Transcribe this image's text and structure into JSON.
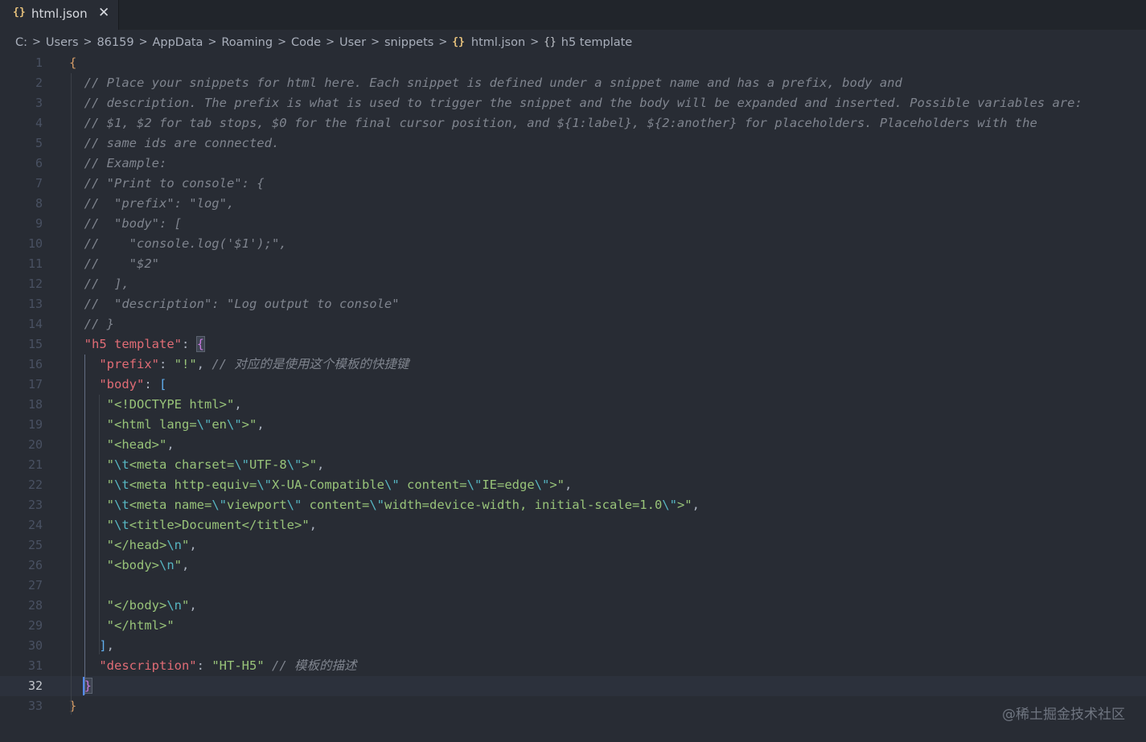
{
  "tab": {
    "icon": "{}",
    "label": "html.json",
    "close": "✕"
  },
  "breadcrumb": {
    "items": [
      "C:",
      "Users",
      "86159",
      "AppData",
      "Roaming",
      "Code",
      "User",
      "snippets"
    ],
    "file_icon": "{}",
    "file": "html.json",
    "symbol_icon": "{}",
    "symbol": "h5 template"
  },
  "editor": {
    "active_line": 32,
    "lines": [
      [
        [
          "{",
          "brace"
        ]
      ],
      [
        [
          "  // Place your snippets for html here. Each snippet is defined under a snippet name and has a prefix, body and",
          "comment"
        ]
      ],
      [
        [
          "  // description. The prefix is what is used to trigger the snippet and the body will be expanded and inserted. Possible variables are:",
          "comment"
        ]
      ],
      [
        [
          "  // $1, $2 for tab stops, $0 for the final cursor position, and ${1:label}, ${2:another} for placeholders. Placeholders with the",
          "comment"
        ]
      ],
      [
        [
          "  // same ids are connected.",
          "comment"
        ]
      ],
      [
        [
          "  // Example:",
          "comment"
        ]
      ],
      [
        [
          "  // \"Print to console\": {",
          "comment"
        ]
      ],
      [
        [
          "  //  \"prefix\": \"log\",",
          "comment"
        ]
      ],
      [
        [
          "  //  \"body\": [",
          "comment"
        ]
      ],
      [
        [
          "  //    \"console.log('$1');\",",
          "comment"
        ]
      ],
      [
        [
          "  //    \"$2\"",
          "comment"
        ]
      ],
      [
        [
          "  //  ],",
          "comment"
        ]
      ],
      [
        [
          "  //  \"description\": \"Log output to console\"",
          "comment"
        ]
      ],
      [
        [
          "  // }",
          "comment"
        ]
      ],
      [
        [
          "  ",
          "punc"
        ],
        [
          "\"h5 template\"",
          "key"
        ],
        [
          ": ",
          "punc"
        ],
        [
          "{",
          "brace-hl"
        ]
      ],
      [
        [
          "    ",
          "punc"
        ],
        [
          "\"prefix\"",
          "key"
        ],
        [
          ": ",
          "punc"
        ],
        [
          "\"!\"",
          "str"
        ],
        [
          ", ",
          "punc"
        ],
        [
          "// 对应的是使用这个模板的快捷键",
          "comment"
        ]
      ],
      [
        [
          "    ",
          "punc"
        ],
        [
          "\"body\"",
          "key"
        ],
        [
          ": ",
          "punc"
        ],
        [
          "[",
          "bracket"
        ]
      ],
      [
        [
          "     ",
          "punc"
        ],
        [
          "\"<!DOCTYPE html>\"",
          "str"
        ],
        [
          ",",
          "punc"
        ]
      ],
      [
        [
          "     ",
          "punc"
        ],
        [
          "\"<html lang=",
          "str"
        ],
        [
          "\\\"",
          "esc"
        ],
        [
          "en",
          "str"
        ],
        [
          "\\\"",
          "esc"
        ],
        [
          ">\"",
          "str"
        ],
        [
          ",",
          "punc"
        ]
      ],
      [
        [
          "     ",
          "punc"
        ],
        [
          "\"<head>\"",
          "str"
        ],
        [
          ",",
          "punc"
        ]
      ],
      [
        [
          "     ",
          "punc"
        ],
        [
          "\"",
          "str"
        ],
        [
          "\\t",
          "esc"
        ],
        [
          "<meta charset=",
          "str"
        ],
        [
          "\\\"",
          "esc"
        ],
        [
          "UTF-8",
          "str"
        ],
        [
          "\\\"",
          "esc"
        ],
        [
          ">\"",
          "str"
        ],
        [
          ",",
          "punc"
        ]
      ],
      [
        [
          "     ",
          "punc"
        ],
        [
          "\"",
          "str"
        ],
        [
          "\\t",
          "esc"
        ],
        [
          "<meta http-equiv=",
          "str"
        ],
        [
          "\\\"",
          "esc"
        ],
        [
          "X-UA-Compatible",
          "str"
        ],
        [
          "\\\"",
          "esc"
        ],
        [
          " content=",
          "str"
        ],
        [
          "\\\"",
          "esc"
        ],
        [
          "IE=edge",
          "str"
        ],
        [
          "\\\"",
          "esc"
        ],
        [
          ">\"",
          "str"
        ],
        [
          ",",
          "punc"
        ]
      ],
      [
        [
          "     ",
          "punc"
        ],
        [
          "\"",
          "str"
        ],
        [
          "\\t",
          "esc"
        ],
        [
          "<meta name=",
          "str"
        ],
        [
          "\\\"",
          "esc"
        ],
        [
          "viewport",
          "str"
        ],
        [
          "\\\"",
          "esc"
        ],
        [
          " content=",
          "str"
        ],
        [
          "\\\"",
          "esc"
        ],
        [
          "width=device-width, initial-scale=1.0",
          "str"
        ],
        [
          "\\\"",
          "esc"
        ],
        [
          ">\"",
          "str"
        ],
        [
          ",",
          "punc"
        ]
      ],
      [
        [
          "     ",
          "punc"
        ],
        [
          "\"",
          "str"
        ],
        [
          "\\t",
          "esc"
        ],
        [
          "<title>Document</title>\"",
          "str"
        ],
        [
          ",",
          "punc"
        ]
      ],
      [
        [
          "     ",
          "punc"
        ],
        [
          "\"</head>",
          "str"
        ],
        [
          "\\n",
          "esc"
        ],
        [
          "\"",
          "str"
        ],
        [
          ",",
          "punc"
        ]
      ],
      [
        [
          "     ",
          "punc"
        ],
        [
          "\"<body>",
          "str"
        ],
        [
          "\\n",
          "esc"
        ],
        [
          "\"",
          "str"
        ],
        [
          ",",
          "punc"
        ]
      ],
      [],
      [
        [
          "     ",
          "punc"
        ],
        [
          "\"</body>",
          "str"
        ],
        [
          "\\n",
          "esc"
        ],
        [
          "\"",
          "str"
        ],
        [
          ",",
          "punc"
        ]
      ],
      [
        [
          "     ",
          "punc"
        ],
        [
          "\"</html>\"",
          "str"
        ]
      ],
      [
        [
          "    ",
          "punc"
        ],
        [
          "]",
          "bracket"
        ],
        [
          ",",
          "punc"
        ]
      ],
      [
        [
          "    ",
          "punc"
        ],
        [
          "\"description\"",
          "key"
        ],
        [
          ": ",
          "punc"
        ],
        [
          "\"HT-H5\"",
          "str"
        ],
        [
          " ",
          "punc"
        ],
        [
          "// 模板的描述",
          "comment"
        ]
      ],
      [
        [
          "  ",
          "punc"
        ],
        [
          "}",
          "brace-hl"
        ]
      ],
      [
        [
          "}",
          "brace"
        ]
      ]
    ]
  },
  "watermark": "@稀土掘金技术社区",
  "colors": {
    "background": "#282c34",
    "comment": "#7f848e",
    "key": "#e06c75",
    "string": "#98c379",
    "escape": "#56b6c2",
    "brace": "#d19a66",
    "cursor": "#528bff"
  }
}
